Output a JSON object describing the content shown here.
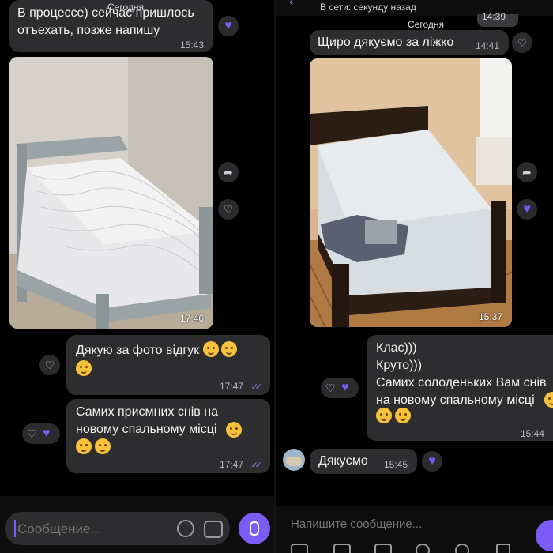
{
  "left": {
    "date_label": "Сегодня",
    "messages": [
      {
        "text": "В процессе) сейчас пришлось\nотъехать, позже напишу",
        "time": "15:43"
      },
      {
        "photo_time": "17:46"
      },
      {
        "text": "Дякую за фото відгук",
        "time": "17:47"
      },
      {
        "text": "Самих приємних снів на\nновому спальному місці",
        "time": "17:47"
      }
    ],
    "composer": {
      "placeholder": "Сообщение..."
    }
  },
  "right": {
    "status": "В сети: секунду назад",
    "top_time": "14:39",
    "date_label": "Сегодня",
    "messages": [
      {
        "text": "Щиро дякуємо за ліжко",
        "time": "14:41"
      },
      {
        "photo_time": "15:37"
      },
      {
        "text": "Клас)))\nКруто)))\nСамих солоденьких Вам снів\nна новому спальному місці",
        "time": "15:44"
      },
      {
        "text": "Дякуємо",
        "time": "15:45"
      }
    ],
    "composer": {
      "placeholder": "Напишите сообщение..."
    }
  },
  "colors": {
    "accent": "#7b5cf6",
    "bubble": "#2d2d30",
    "background": "#000000"
  }
}
